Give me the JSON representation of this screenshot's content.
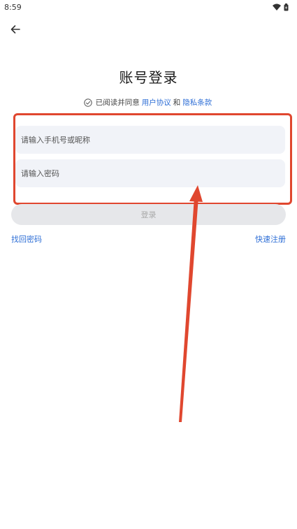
{
  "status_bar": {
    "time": "8:59",
    "icons": [
      "wifi-icon",
      "battery-icon"
    ]
  },
  "header": {
    "back_icon": "arrow-left-icon",
    "title": "账号登录"
  },
  "agreement": {
    "check_icon": "circle-check-icon",
    "prefix": "已阅读并同意",
    "user_agreement": "用户协议",
    "conjunction": "和",
    "privacy_policy": "隐私条款"
  },
  "form": {
    "phone_placeholder": "请输入手机号或昵称",
    "password_placeholder": "请输入密码",
    "login_label": "登录"
  },
  "footer_links": {
    "forgot_password": "找回密码",
    "quick_register": "快速注册"
  },
  "colors": {
    "link": "#2f6fd6",
    "highlight": "#e0472f",
    "input_bg": "#f1f3f8",
    "button_disabled_bg": "#e6e7ea"
  }
}
